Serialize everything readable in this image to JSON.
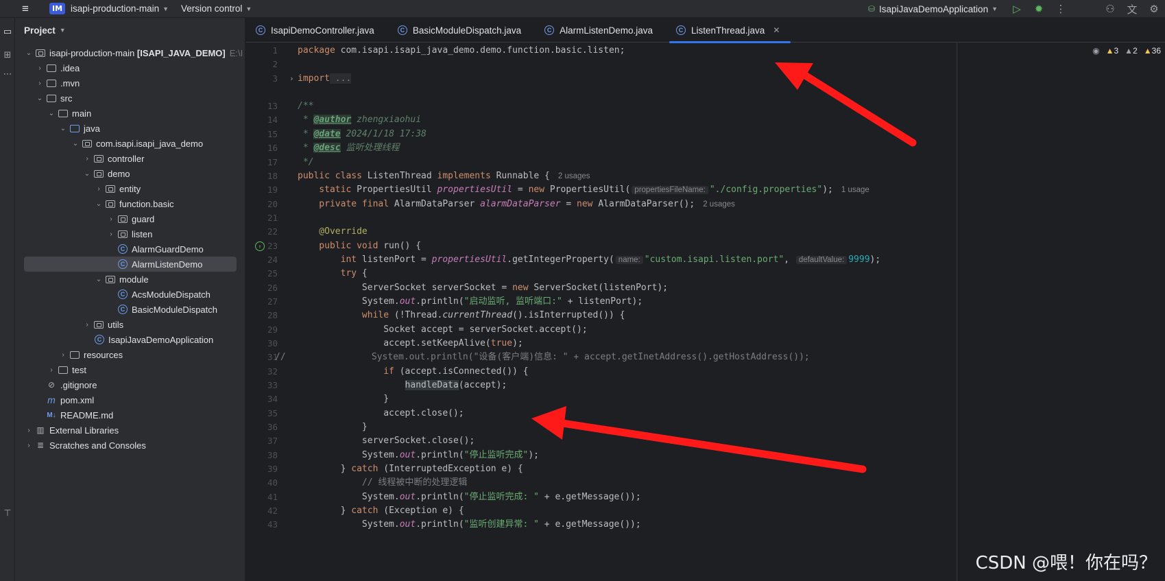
{
  "titlebar": {
    "project_badge": "IM",
    "project_name": "isapi-production-main",
    "vcs_label": "Version control",
    "run_config": "IsapiJavaDemoApplication"
  },
  "project_panel": {
    "title": "Project",
    "root_label": "isapi-production-main",
    "root_module": "[ISAPI_JAVA_DEMO]",
    "root_path": "E:\\I",
    "items": [
      {
        "label": ".idea"
      },
      {
        "label": ".mvn"
      },
      {
        "label": "src"
      },
      {
        "label": "main"
      },
      {
        "label": "java"
      },
      {
        "label": "com.isapi.isapi_java_demo"
      },
      {
        "label": "controller"
      },
      {
        "label": "demo"
      },
      {
        "label": "entity"
      },
      {
        "label": "function.basic"
      },
      {
        "label": "guard"
      },
      {
        "label": "listen"
      },
      {
        "label": "AlarmGuardDemo"
      },
      {
        "label": "AlarmListenDemo"
      },
      {
        "label": "module"
      },
      {
        "label": "AcsModuleDispatch"
      },
      {
        "label": "BasicModuleDispatch"
      },
      {
        "label": "utils"
      },
      {
        "label": "IsapiJavaDemoApplication"
      },
      {
        "label": "resources"
      },
      {
        "label": "test"
      },
      {
        "label": ".gitignore"
      },
      {
        "label": "pom.xml"
      },
      {
        "label": "README.md"
      },
      {
        "label": "External Libraries"
      },
      {
        "label": "Scratches and Consoles"
      }
    ]
  },
  "tabs": [
    {
      "label": "IsapiDemoController.java"
    },
    {
      "label": "BasicModuleDispatch.java"
    },
    {
      "label": "AlarmListenDemo.java"
    },
    {
      "label": "ListenThread.java"
    }
  ],
  "inspections": {
    "warnings": "3",
    "weak_warnings": "2",
    "typos": "36"
  },
  "line_numbers": [
    "1",
    "2",
    "3",
    "13",
    "14",
    "15",
    "16",
    "17",
    "18",
    "19",
    "20",
    "21",
    "22",
    "23",
    "24",
    "25",
    "26",
    "27",
    "28",
    "29",
    "30",
    "31",
    "32",
    "33",
    "34",
    "35",
    "36",
    "37",
    "38",
    "39",
    "40",
    "41",
    "42",
    "43"
  ],
  "code": {
    "l1_pkg": "package",
    "l1_rest": " com.isapi.isapi_java_demo.demo.function.basic.listen;",
    "l3_import": "import",
    "l3_rest": " ...",
    "l13": "/**",
    "l14_star": " * ",
    "l14_tag": "@author",
    "l14_val": " zhengxiaohui",
    "l15_star": " * ",
    "l15_tag": "@date",
    "l15_val": " 2024/1/18 17:38",
    "l16_star": " * ",
    "l16_tag": "@desc",
    "l16_val": " 监听处理线程",
    "l17": " */",
    "l18_kw": "public class",
    "l18_name": " ListenThread ",
    "l18_kw2": "implements",
    "l18_rest": " Runnable {",
    "l18_usage": "2 usages",
    "l19_kw": "    static",
    "l19_type": " PropertiesUtil ",
    "l19_fld": "propertiesUtil",
    "l19_eq": " = ",
    "l19_new": "new",
    "l19_call": " PropertiesUtil(",
    "l19_hint": "propertiesFileName:",
    "l19_str": "\"./config.properties\"",
    "l19_end": ");",
    "l19_usage": "1 usage",
    "l20_kw": "    private final",
    "l20_type": " AlarmDataParser ",
    "l20_fld": "alarmDataParser",
    "l20_eq": " = ",
    "l20_new": "new",
    "l20_call": " AlarmDataParser();",
    "l20_usage": "2 usages",
    "l22": "    @Override",
    "l23_kw": "    public void",
    "l23_rest": " run() {",
    "l24_kw": "        int",
    "l24_a": " listenPort = ",
    "l24_fld": "propertiesUtil",
    "l24_b": ".getIntegerProperty(",
    "l24_hint1": "name:",
    "l24_str": "\"custom.isapi.listen.port\"",
    "l24_c": ", ",
    "l24_hint2": "defaultValue:",
    "l24_num": "9999",
    "l24_end": ");",
    "l25_kw": "        try",
    "l25_rest": " {",
    "l26_a": "            ServerSocket serverSocket = ",
    "l26_new": "new",
    "l26_b": " ServerSocket(listenPort);",
    "l27_a": "            System.",
    "l27_out": "out",
    "l27_b": ".println(",
    "l27_str": "\"启动监听, 监听端口:\"",
    "l27_c": " + listenPort);",
    "l28_kw": "            while",
    "l28_a": " (!Thread.",
    "l28_it": "currentThread",
    "l28_b": "().isInterrupted()) {",
    "l29": "                Socket accept = serverSocket.accept();",
    "l30_a": "                accept.setKeepAlive(",
    "l30_kw": "true",
    "l30_b": ");",
    "l31": "//                System.out.println(\"设备(客户端)信息: \" + accept.getInetAddress().getHostAddress());",
    "l32_kw": "                if",
    "l32_rest": " (accept.isConnected()) {",
    "l33_pad": "                    ",
    "l33_call": "handleData",
    "l33_rest": "(accept);",
    "l34": "                }",
    "l35": "                accept.close();",
    "l36": "            }",
    "l37": "            serverSocket.close();",
    "l38_a": "            System.",
    "l38_out": "out",
    "l38_b": ".println(",
    "l38_str": "\"停止监听完成\"",
    "l38_c": ");",
    "l39_a": "        } ",
    "l39_kw": "catch",
    "l39_b": " (InterruptedException e) {",
    "l40": "            // 线程被中断的处理逻辑",
    "l41_a": "            System.",
    "l41_out": "out",
    "l41_b": ".println(",
    "l41_str": "\"停止监听完成: \"",
    "l41_c": " + e.getMessage());",
    "l42_a": "        } ",
    "l42_kw": "catch",
    "l42_b": " (Exception e) {",
    "l43_a": "            System.",
    "l43_out": "out",
    "l43_b": ".println(",
    "l43_str": "\"监听创建异常: \"",
    "l43_c": " + e.getMessage());"
  },
  "watermark": "CSDN @喂！你在吗？",
  "colors": {
    "accent": "#3574f0",
    "annotation_arrow": "#ff1a1a",
    "background": "#1e1f22"
  }
}
